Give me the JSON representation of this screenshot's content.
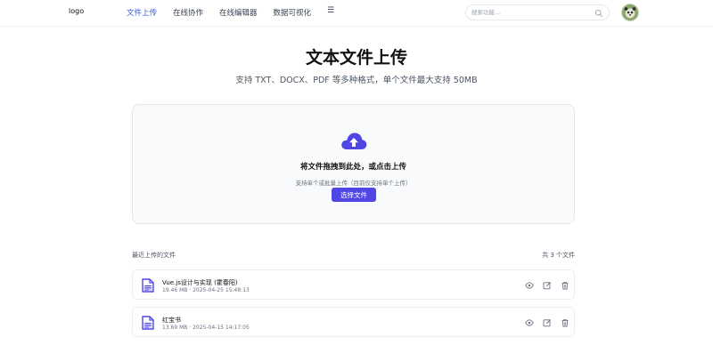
{
  "header": {
    "logo": "logo",
    "nav": [
      {
        "label": "文件上传",
        "active": true
      },
      {
        "label": "在线协作",
        "active": false
      },
      {
        "label": "在线编辑器",
        "active": false
      },
      {
        "label": "数据可视化",
        "active": false
      }
    ],
    "menu_icon": "☰",
    "search_placeholder": "搜索功能..."
  },
  "hero": {
    "title": "文本文件上传",
    "subtitle": "支持 TXT、DOCX、PDF 等多种格式，单个文件最大支持 50MB"
  },
  "upload": {
    "title": "将文件拖拽到此处，或点击上传",
    "hint": "支持单个或批量上传（目前仅支持单个上传）",
    "button": "选择文件"
  },
  "recent": {
    "heading": "最近上传的文件",
    "count": "共 3 个文件",
    "files": [
      {
        "name": "Vue.js设计与实现 (霍春阳)",
        "meta": "19.46 MB · 2025-04-25 15:48:13"
      },
      {
        "name": "红宝书",
        "meta": "13.69 MB · 2025-04-15 14:17:05"
      }
    ]
  },
  "colors": {
    "accent": "#4f46e5",
    "nav_active": "#3b5bdb"
  }
}
